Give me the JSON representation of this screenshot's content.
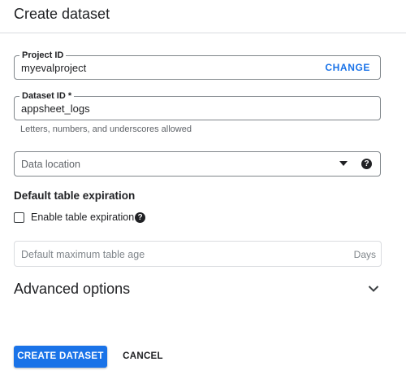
{
  "header": {
    "title": "Create dataset"
  },
  "project_id": {
    "label": "Project ID",
    "value": "myevalproject",
    "action": "CHANGE"
  },
  "dataset_id": {
    "label": "Dataset ID *",
    "value": "appsheet_logs",
    "hint": "Letters, numbers, and underscores allowed"
  },
  "data_location": {
    "placeholder": "Data location",
    "help_icon": "?"
  },
  "expiration": {
    "section_title": "Default table expiration",
    "checkbox_label": "Enable table expiration",
    "checked": false,
    "help_icon": "?",
    "max_age_placeholder": "Default maximum table age",
    "max_age_suffix": "Days"
  },
  "advanced": {
    "label": "Advanced options"
  },
  "actions": {
    "create": "CREATE DATASET",
    "cancel": "CANCEL"
  },
  "colors": {
    "accent": "#1a73e8",
    "border": "#80868b",
    "divider": "#dadce0"
  }
}
